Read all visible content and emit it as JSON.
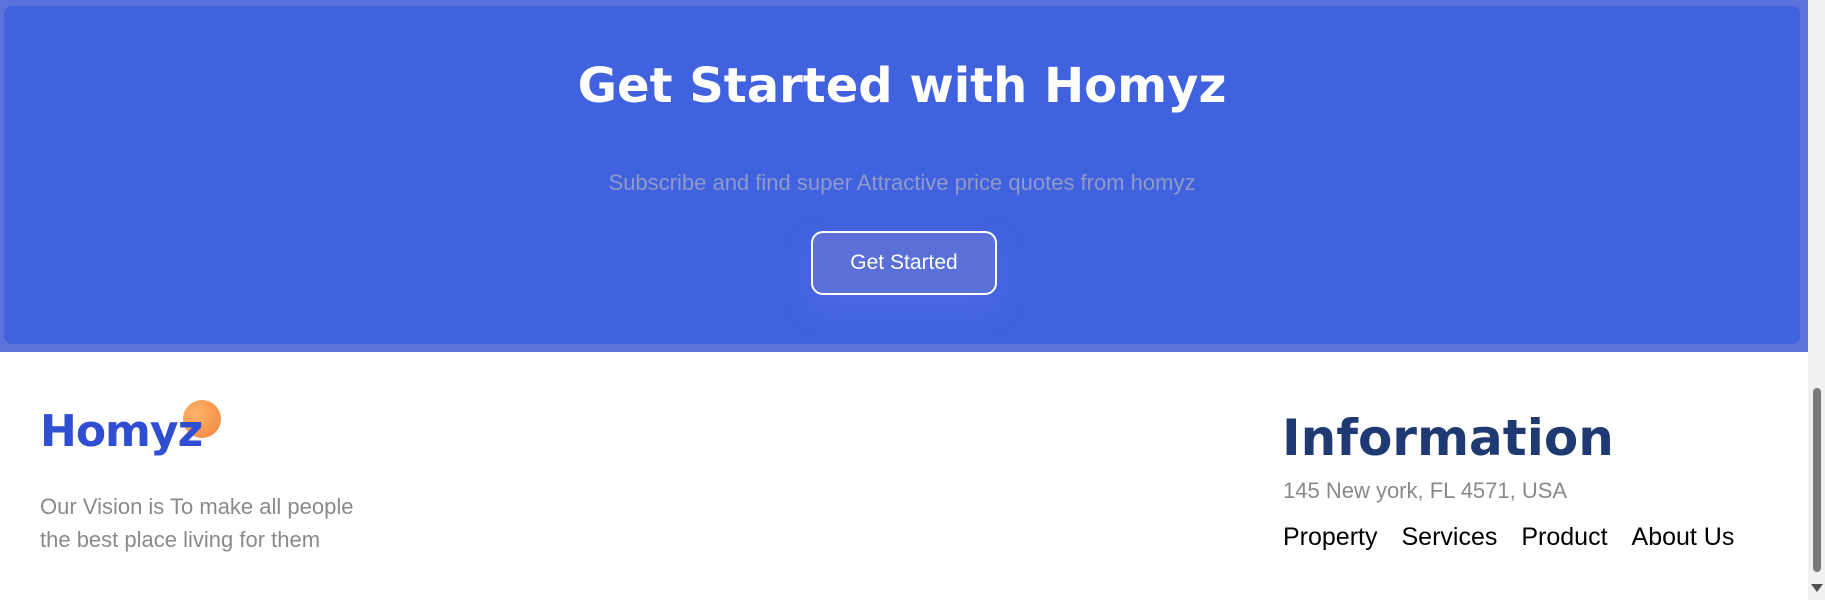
{
  "cta": {
    "title": "Get Started with Homyz",
    "subtitle": "Subscribe and find super Attractive price quotes from homyz",
    "button_label": "Get Started"
  },
  "footer": {
    "brand": "Homyz",
    "vision_line1": "Our Vision is To make all people",
    "vision_line2": "the best place living for them",
    "info": {
      "title": "Information",
      "address": "145 New york, FL 4571, USA",
      "links": [
        "Property",
        "Services",
        "Product",
        "About Us"
      ]
    }
  },
  "colors": {
    "banner": "#4162df",
    "brand_text": "#2f4ed1",
    "brand_dot": "#f5924a",
    "info_title": "#1f3a73"
  },
  "icons": {
    "brand_dot": "orange-circle-logo-mark",
    "scroll_down": "scroll-down-arrow-icon"
  }
}
